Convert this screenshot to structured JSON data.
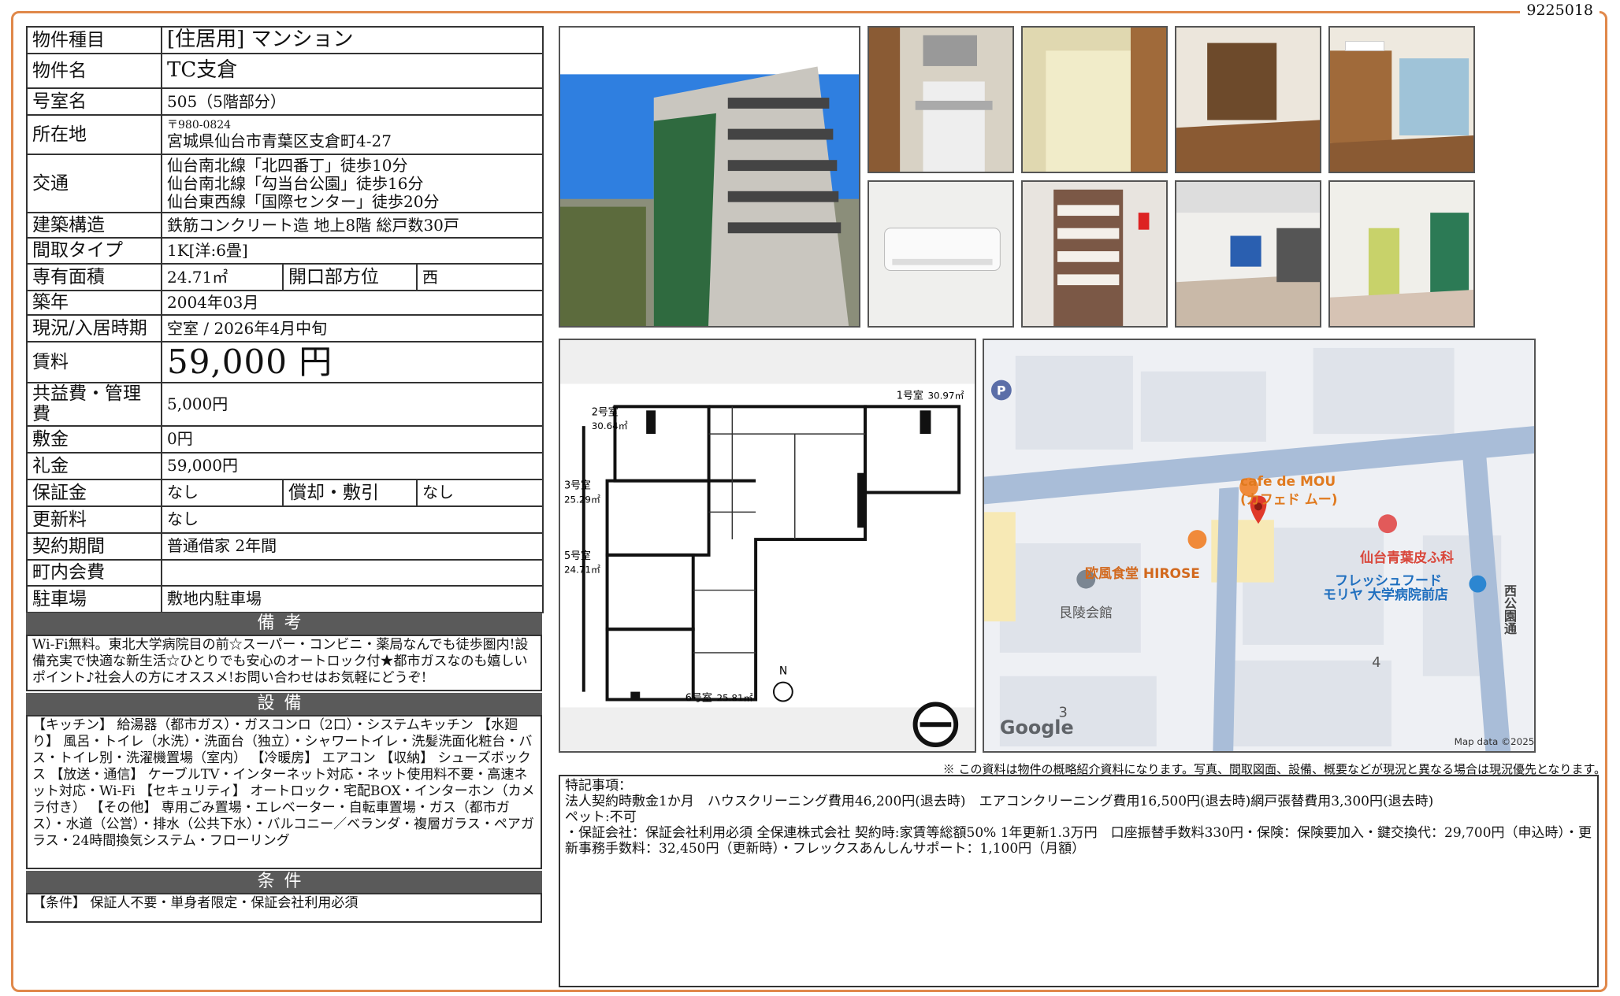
{
  "doc_id": "9225018",
  "info": {
    "type_label": "物件種目",
    "type_value": "[住居用]  マンション",
    "name_label": "物件名",
    "name_value": "TC支倉",
    "room_label": "号室名",
    "room_value": "505（5階部分）",
    "addr_label": "所在地",
    "addr_zip": "〒980-0824",
    "addr_value": "宮城県仙台市青葉区支倉町4-27",
    "access_label": "交通",
    "access": [
      "仙台南北線「北四番丁」徒歩10分",
      "仙台南北線「勾当台公園」徒歩16分",
      "仙台東西線「国際センター」徒歩20分"
    ],
    "structure_label": "建築構造",
    "structure_value": "鉄筋コンクリート造  地上8階  総戸数30戸",
    "layout_label": "間取タイプ",
    "layout_value": "1K[洋:6畳]",
    "area_label": "専有面積",
    "area_value": "24.71㎡",
    "opening_label": "開口部方位",
    "opening_value": "西",
    "built_label": "築年",
    "built_value": "2004年03月",
    "status_label": "現況/入居時期",
    "status_value": "空室  /  2026年4月中旬",
    "rent_label": "賃料",
    "rent_value": "59,000 円",
    "fee_label": "共益費・管理費",
    "fee_value": "5,000円",
    "deposit_label": "敷金",
    "deposit_value": "0円",
    "key_label": "礼金",
    "key_value": "59,000円",
    "guarantee_label": "保証金",
    "guarantee_value": "なし",
    "amort_label": "償却・敷引",
    "amort_value": "なし",
    "renew_label": "更新料",
    "renew_value": "なし",
    "contract_label": "契約期間",
    "contract_value": "普通借家  2年間",
    "town_label": "町内会費",
    "town_value": "",
    "parking_label": "駐車場",
    "parking_value": "敷地内駐車場"
  },
  "sections": {
    "remarks_title": "備考",
    "remarks_text": "Wi-Fi無料。東北大学病院目の前☆スーパー・コンビニ・薬局なんでも徒歩圏内!設備充実で快適な新生活☆ひとりでも安心のオートロック付★都市ガスなのも嬉しいポイント♪社会人の方にオススメ!お問い合わせはお気軽にどうぞ!",
    "equipment_title": "設備",
    "equipment_text": "【キッチン】 給湯器（都市ガス）・ガスコンロ（2口）・システムキッチン 【水廻り】 風呂・トイレ（水洗）・洗面台（独立）・シャワートイレ・洗髪洗面化粧台・バス・トイレ別・洗濯機置場（室内） 【冷暖房】 エアコン 【収納】 シューズボックス 【放送・通信】 ケーブルTV・インターネット対応・ネット使用料不要・高速ネット対応・Wi-Fi 【セキュリティ】 オートロック・宅配BOX・インターホン（カメラ付き） 【その他】 専用ごみ置場・エレベーター・自転車置場・ガス（都市ガス）・水道（公営）・排水（公共下水）・バルコニー／ベランダ・複層ガラス・ペアガラス・24時間換気システム・フローリング",
    "conditions_title": "条件",
    "conditions_text": "【条件】 保証人不要・単身者限定・保証会社利用必須"
  },
  "floorplan": {
    "units": [
      "2号室",
      "30.64㎡",
      "1号室",
      "30.97㎡",
      "3号室",
      "25.29㎡",
      "5号室",
      "24.71㎡",
      "6号室",
      "25.81㎡"
    ],
    "north": "N"
  },
  "map": {
    "places": [
      "cafe de MOU",
      "(カフェド ムー)",
      "仙台青葉皮ふ科",
      "欧風食堂 HIROSE",
      "フレッシュフード",
      "モリヤ 大学病院前店",
      "艮陵会館",
      "西公園通"
    ],
    "numbers": [
      "3",
      "4"
    ],
    "parking": "P",
    "google": "Google",
    "attribution": "Map data ©2025"
  },
  "disclaimer": "※ この資料は物件の概略紹介資料になります。写真、間取図面、設備、概要などが現況と異なる場合は現況優先となります。",
  "special": {
    "title": "特記事項：",
    "line1": "法人契約時敷金1か月　ハウスクリーニング費用46,200円(退去時)　エアコンクリーニング費用16,500円(退去時)網戸張替費用3,300円(退去時)",
    "line2": "ペット:不可",
    "line3": "・保証会社：保証会社利用必須 全保連株式会社 契約時:家賃等総額50% 1年更新1.3万円　口座振替手数料330円・保険：保険要加入・鍵交換代：29,700円（申込時）・更新事務手数料：32,450円（更新時）・フレックスあんしんサポート：1,100円（月額）"
  },
  "colors": {
    "frame": "#e0884a",
    "section_bar": "#5a5a5a"
  }
}
